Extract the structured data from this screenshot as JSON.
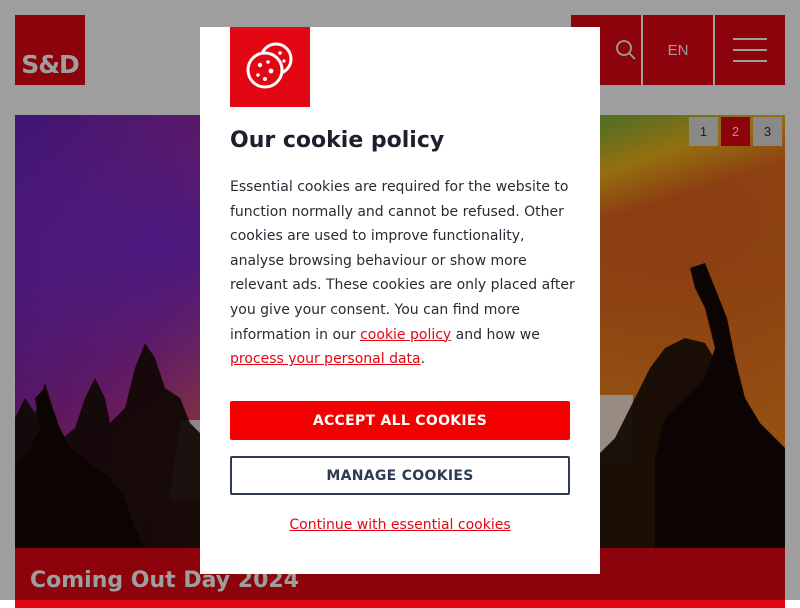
{
  "header": {
    "logo_text": "S&D",
    "language": "EN",
    "search_icon": "search-icon",
    "menu_icon": "hamburger-menu-icon"
  },
  "hero": {
    "pager": [
      "1",
      "2",
      "3"
    ],
    "active_page": "2",
    "caption": "Coming Out Day 2024"
  },
  "cookie_modal": {
    "icon": "cookie-icon",
    "title": "Our cookie policy",
    "body_intro": "Essential cookies are required for the website to function normally and cannot be refused. Other cookies are used to improve functionality, analyse browsing behaviour or show more relevant ads. These cookies are only placed after you give your consent. You can find more information in our ",
    "cookie_policy_link": "cookie policy",
    "body_middle": " and how we ",
    "personal_data_link": "process your personal data",
    "body_end": ".",
    "accept_label": "ACCEPT ALL COOKIES",
    "manage_label": "MANAGE COOKIES",
    "essential_label": "Continue with essential cookies"
  },
  "colors": {
    "brand_red": "#e30613",
    "accept_red": "#f50000",
    "manage_border": "#2d3b52"
  }
}
